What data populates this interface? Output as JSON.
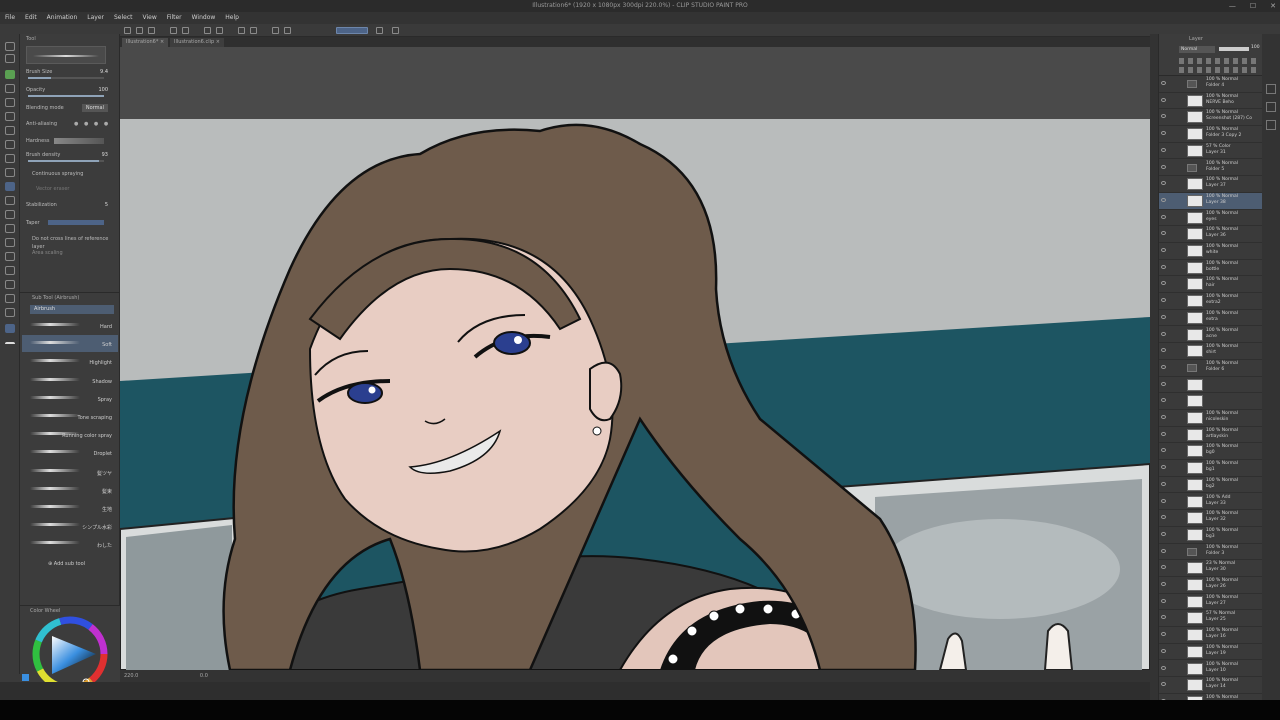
{
  "window": {
    "title": "Illustration6* (1920 x 1080px 300dpi 220.0%) - CLIP STUDIO PAINT PRO"
  },
  "menu": [
    "File",
    "Edit",
    "Animation",
    "Layer",
    "Select",
    "View",
    "Filter",
    "Window",
    "Help"
  ],
  "tabs": [
    "Illustration6*",
    "Illustration6.clip"
  ],
  "tool_property": {
    "panel_title": "Tool",
    "brush_size_label": "Brush Size",
    "brush_size_value": "9.4",
    "brush_size_level": 0.3,
    "opacity_label": "Opacity",
    "opacity_value": "100",
    "opacity_level": 1.0,
    "blending_label": "Blending mode",
    "blending_value": "Normal",
    "antialiasing_label": "Anti-aliasing",
    "hardness_label": "Hardness",
    "density_label": "Brush density",
    "density_value": "93",
    "density_level": 0.93,
    "continuous_label": "Continuous spraying",
    "vector_label": "Vector eraser",
    "stabilization_label": "Stabilization",
    "stabilization_value": "5",
    "taper_label": "Taper",
    "ref_label": "Do not cross lines of reference layer",
    "area_label": "Area scaling"
  },
  "subtool": {
    "header": "Sub Tool (Airbrush)",
    "group": "Airbrush",
    "items": [
      {
        "label": "Hard"
      },
      {
        "label": "Soft",
        "selected": true
      },
      {
        "label": "Highlight"
      },
      {
        "label": "Shadow"
      },
      {
        "label": "Spray"
      },
      {
        "label": "Tone scraping"
      },
      {
        "label": "Running color spray"
      },
      {
        "label": "Droplet"
      },
      {
        "label": "髪ツヤ"
      },
      {
        "label": "髪束"
      },
      {
        "label": "生地"
      },
      {
        "label": "シンプル水彩"
      },
      {
        "label": "わした"
      }
    ],
    "add_label": "Add sub tool"
  },
  "color_wheel": {
    "title": "Color Wheel",
    "values": "56 • 160 • 225"
  },
  "status": {
    "zoom": "220.0",
    "rotation": "0.0"
  },
  "layer_panel": {
    "title": "Layer",
    "blend_mode": "Normal",
    "opacity": "100",
    "layers": [
      {
        "mode": "100 % Normal",
        "name": "Folder 4",
        "folder": true
      },
      {
        "mode": "100 % Normal",
        "name": "NERVE Beho"
      },
      {
        "mode": "100 % Normal",
        "name": "Screenshot (287) Co"
      },
      {
        "mode": "100 % Normal",
        "name": "Folder 3 Copy 2"
      },
      {
        "mode": "57 % Color",
        "name": "Layer 31"
      },
      {
        "mode": "100 % Normal",
        "name": "Folder 5",
        "folder": true
      },
      {
        "mode": "100 % Normal",
        "name": "Layer 37"
      },
      {
        "mode": "100 % Normal",
        "name": "Layer 38",
        "selected": true
      },
      {
        "mode": "100 % Normal",
        "name": "eyes"
      },
      {
        "mode": "100 % Normal",
        "name": "Layer 36"
      },
      {
        "mode": "100 % Normal",
        "name": "white"
      },
      {
        "mode": "100 % Normal",
        "name": "bottle"
      },
      {
        "mode": "100 % Normal",
        "name": "hair"
      },
      {
        "mode": "100 % Normal",
        "name": "extra2"
      },
      {
        "mode": "100 % Normal",
        "name": "extra"
      },
      {
        "mode": "100 % Normal",
        "name": "acne"
      },
      {
        "mode": "100 % Normal",
        "name": "shirt"
      },
      {
        "mode": "100 % Normal",
        "name": "Folder 6",
        "folder": true
      },
      {
        "mode": "",
        "name": ""
      },
      {
        "mode": "",
        "name": ""
      },
      {
        "mode": "100 % Normal",
        "name": "nicoleskin"
      },
      {
        "mode": "100 % Normal",
        "name": "artlayskin"
      },
      {
        "mode": "100 % Normal",
        "name": "bg0"
      },
      {
        "mode": "100 % Normal",
        "name": "bg1"
      },
      {
        "mode": "100 % Normal",
        "name": "bg2"
      },
      {
        "mode": "100 % Add",
        "name": "Layer 33"
      },
      {
        "mode": "100 % Normal",
        "name": "Layer 32"
      },
      {
        "mode": "100 % Normal",
        "name": "bg3"
      },
      {
        "mode": "100 % Normal",
        "name": "Folder 3",
        "folder": true
      },
      {
        "mode": "23 % Normal",
        "name": "Layer 30"
      },
      {
        "mode": "100 % Normal",
        "name": "Layer 26"
      },
      {
        "mode": "100 % Normal",
        "name": "Layer 27"
      },
      {
        "mode": "57 % Normal",
        "name": "Layer 25"
      },
      {
        "mode": "100 % Normal",
        "name": "Layer 16"
      },
      {
        "mode": "100 % Normal",
        "name": "Layer 19"
      },
      {
        "mode": "100 % Normal",
        "name": "Layer 10"
      },
      {
        "mode": "100 % Normal",
        "name": "Layer 14"
      },
      {
        "mode": "100 % Normal",
        "name": "Layer 10 Copy"
      }
    ]
  },
  "colors": {
    "canvas_bg": "#b9bcbc",
    "wall_teal": "#1d5562",
    "hair": "#6e5b4b",
    "skin": "#e8cdc3",
    "shirt": "#3a3a3a",
    "eye": "#2b3f8f",
    "accent_select": "#4d5d72"
  }
}
